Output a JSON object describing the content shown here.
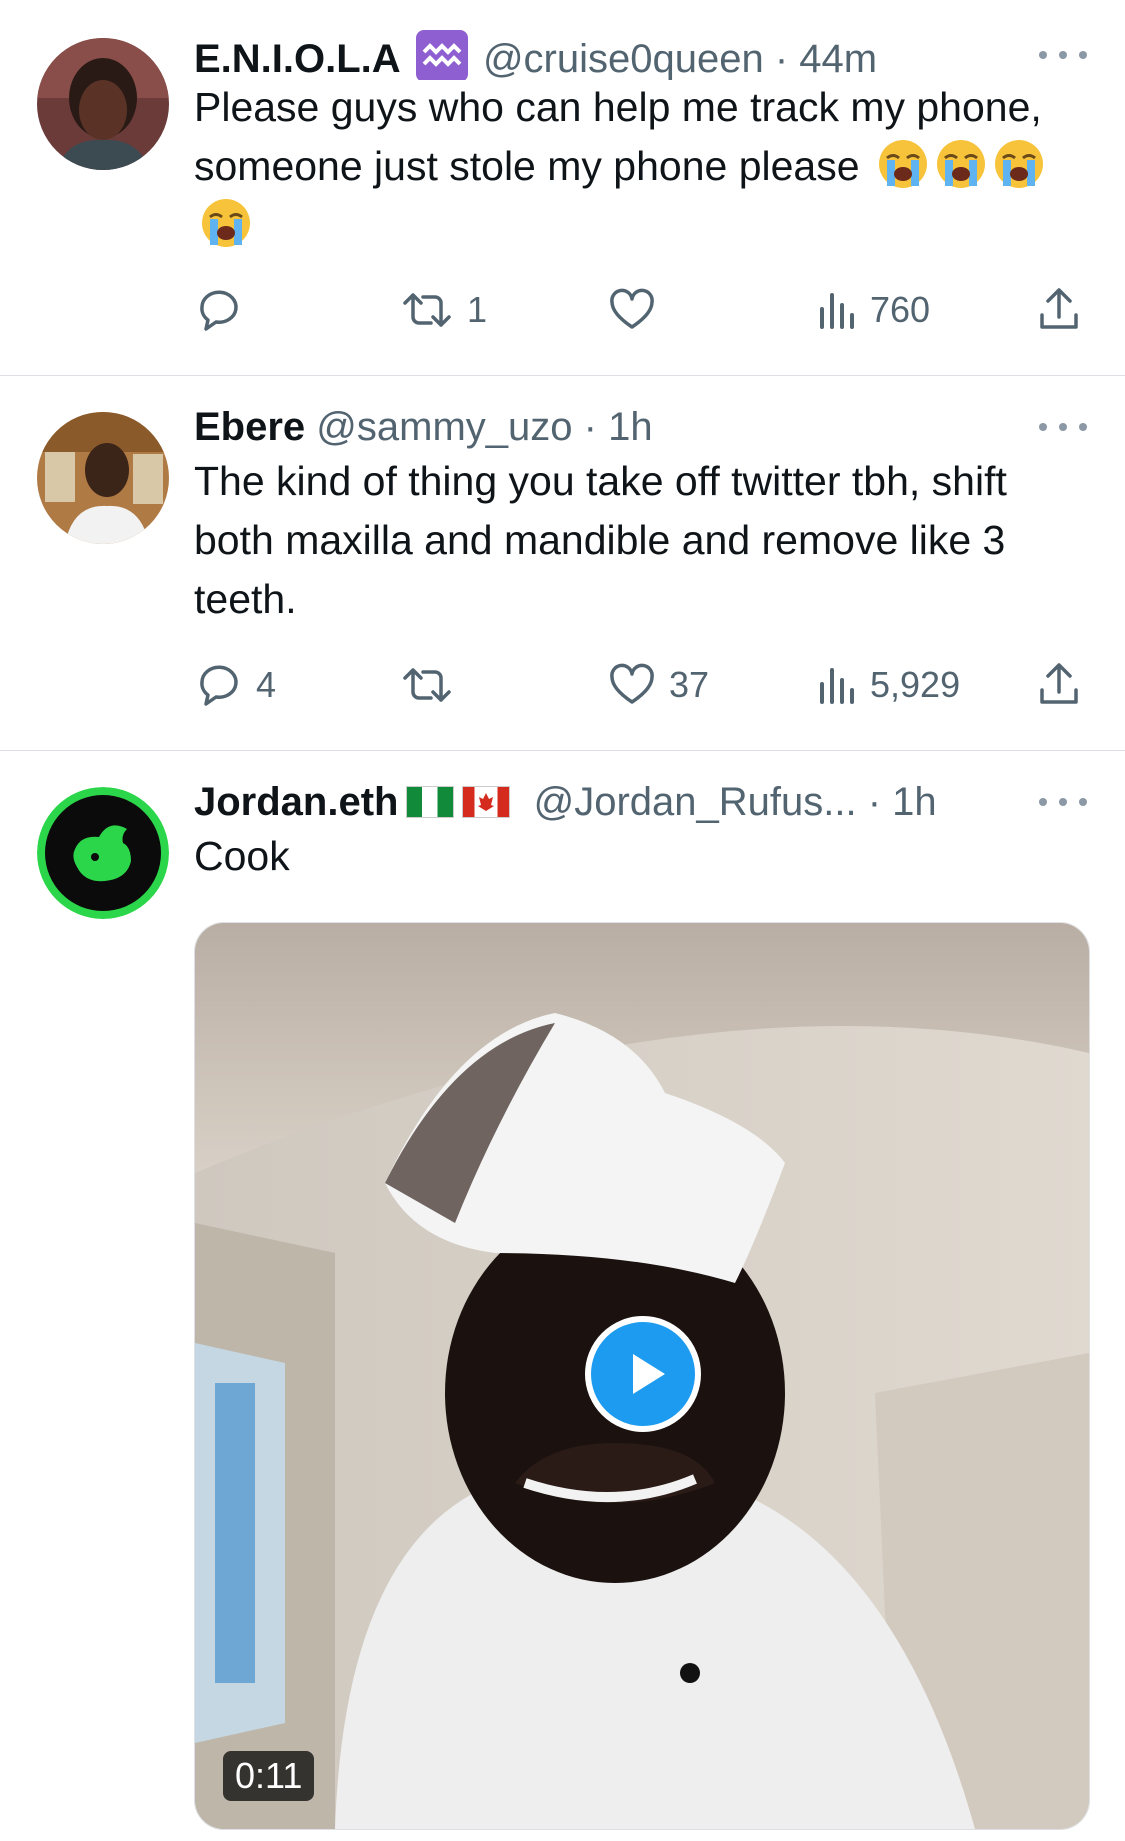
{
  "tweets": [
    {
      "name": "E.N.I.O.L.A",
      "name_emoji": "aquarius-icon",
      "handle": "@cruise0queen",
      "time": "· 44m",
      "text": "Please guys who can help me track my phone, someone just stole my phone please",
      "text_emojis": [
        "loudly-crying-face-icon",
        "loudly-crying-face-icon",
        "loudly-crying-face-icon",
        "loudly-crying-face-icon"
      ],
      "replies": "",
      "retweets": "1",
      "likes": "",
      "views": "760"
    },
    {
      "name": "Ebere",
      "handle": "@sammy_uzo",
      "time": "· 1h",
      "text": "The kind of thing you take off twitter tbh, shift both maxilla and mandible and remove like 3 teeth.",
      "replies": "4",
      "retweets": "",
      "likes": "37",
      "views": "5,929"
    },
    {
      "name": "Jordan.eth",
      "name_flags": [
        "nigeria-flag-icon",
        "canada-flag-icon"
      ],
      "handle": "@Jordan_Rufus...",
      "time": "· 1h",
      "text": "Cook",
      "video": {
        "duration": "0:11"
      }
    }
  ],
  "colors": {
    "text": "#0f1419",
    "secondary": "#536471",
    "divider": "#dcdfe3",
    "play_button": "#1d9bf0"
  }
}
